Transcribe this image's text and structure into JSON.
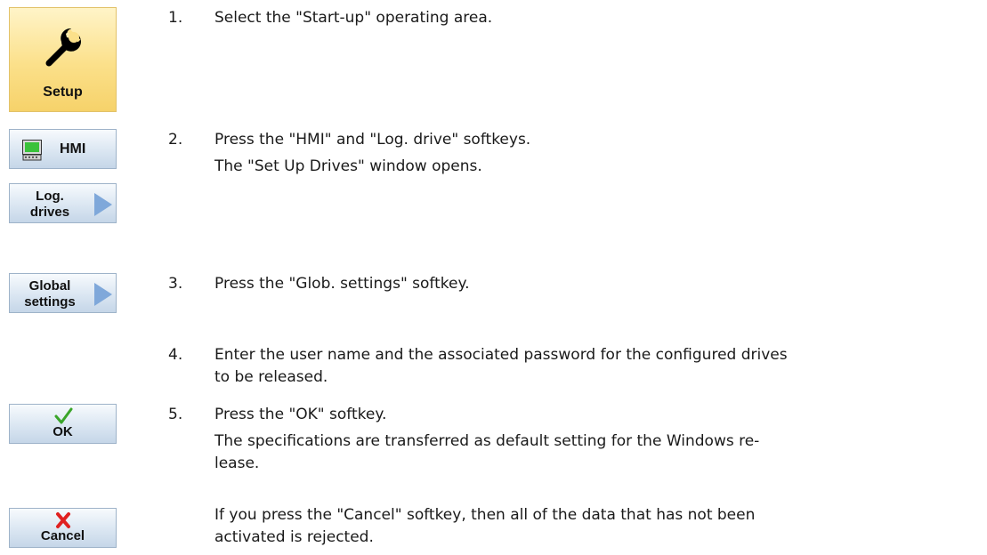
{
  "softkeys": {
    "setup": {
      "label": "Setup",
      "icon": "wrench-icon"
    },
    "hmi": {
      "label": "HMI",
      "icon": "monitor-icon"
    },
    "log_drives": {
      "label_line1": "Log.",
      "label_line2": "drives"
    },
    "global_settings": {
      "label_line1": "Global",
      "label_line2": "settings"
    },
    "ok": {
      "label": "OK",
      "icon": "checkmark-icon",
      "icon_color": "#3aa52a"
    },
    "cancel": {
      "label": "Cancel",
      "icon": "cross-icon",
      "icon_color": "#e02020"
    }
  },
  "steps": [
    {
      "number": "1.",
      "lines": [
        "Select the \"Start-up\" operating area."
      ]
    },
    {
      "number": "2.",
      "lines": [
        "Press the \"HMI\" and \"Log. drive\" softkeys.",
        "The \"Set Up Drives\" window opens."
      ]
    },
    {
      "number": "3.",
      "lines": [
        "Press the \"Glob. settings\" softkey."
      ]
    },
    {
      "number": "4.",
      "lines": [
        "Enter the user name and the associated password for the configured drives",
        "to be released."
      ]
    },
    {
      "number": "5.",
      "lines": [
        "Press the \"OK\" softkey.",
        "The specifications are transferred as default setting for the Windows re-",
        "lease."
      ]
    }
  ],
  "cancel_note": {
    "lines": [
      "If you press the \"Cancel\" softkey, then all of the data that has not been",
      "activated is rejected."
    ]
  }
}
